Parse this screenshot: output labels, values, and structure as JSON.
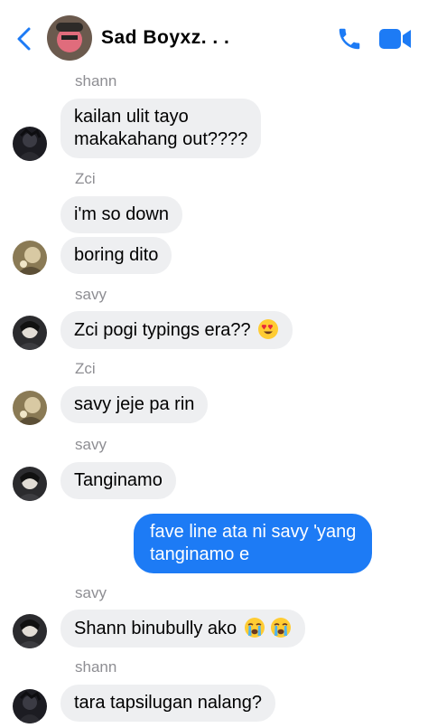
{
  "header": {
    "title": "Sad Boyxz. . .",
    "icons": {
      "back": "chevron-left-icon",
      "call": "phone-icon",
      "video": "video-camera-icon"
    },
    "accent_color": "#1d7bf5"
  },
  "messages": [
    {
      "sender": "shann",
      "text_lines": [
        "kailan ulit tayo",
        "makakahang out????"
      ]
    },
    {
      "sender": "Zci",
      "text": "i'm so down"
    },
    {
      "text": "boring dito"
    },
    {
      "sender": "savy",
      "text": "Zci pogi typings era??",
      "emoji": "heart-eyes-emoji"
    },
    {
      "sender": "Zci",
      "text": "savy jeje pa rin"
    },
    {
      "sender": "savy",
      "text": "Tanginamo"
    },
    {
      "outgoing": true,
      "text_lines": [
        "fave line ata ni savy 'yang",
        "tanginamo e"
      ]
    },
    {
      "sender": "savy",
      "text": "Shann binubully ako",
      "emoji": "loudly-crying-emoji",
      "emoji_count": 2
    },
    {
      "sender": "shann",
      "text": "tara tapsilugan nalang?"
    }
  ],
  "colors": {
    "incoming_bubble": "#eeeff1",
    "outgoing_bubble": "#1d7bf5",
    "sender_name": "#8e8e93"
  }
}
